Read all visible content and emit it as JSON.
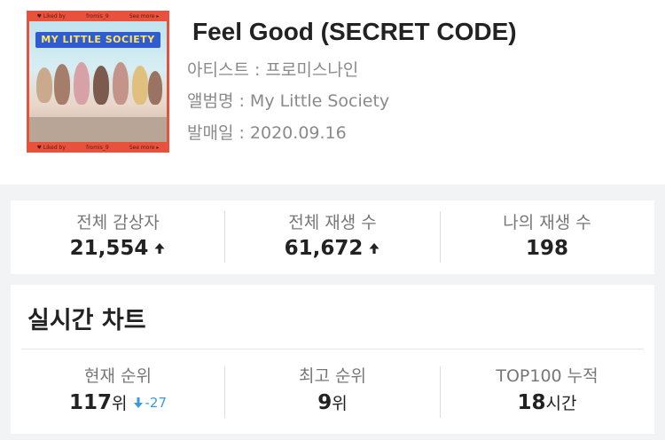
{
  "album": {
    "cover_title": "MY LITTLE SOCIETY",
    "cover_strip_left": "♥ Liked by",
    "cover_strip_mid": "fromis_9",
    "cover_strip_right": "See more ▸"
  },
  "song": {
    "title": "Feel Good (SECRET CODE)",
    "artist_line": "아티스트 : 프로미스나인",
    "album_line": "앨범명 : My Little Society",
    "release_line": "발매일 : 2020.09.16"
  },
  "stats": {
    "total_listeners_label": "전체 감상자",
    "total_listeners_value": "21,554",
    "total_plays_label": "전체 재생 수",
    "total_plays_value": "61,672",
    "my_plays_label": "나의 재생 수",
    "my_plays_value": "198"
  },
  "chart": {
    "title": "실시간 차트",
    "current_rank_label": "현재 순위",
    "current_rank_value": "117",
    "current_rank_unit": "위",
    "current_rank_change": "-27",
    "best_rank_label": "최고 순위",
    "best_rank_value": "9",
    "best_rank_unit": "위",
    "top100_label": "TOP100 누적",
    "top100_value": "18",
    "top100_unit": "시간"
  },
  "icons": {
    "up": "arrow-up-icon",
    "down": "arrow-down-icon"
  },
  "colors": {
    "delta": "#3a9bdc",
    "cover_border": "#e8513c"
  }
}
